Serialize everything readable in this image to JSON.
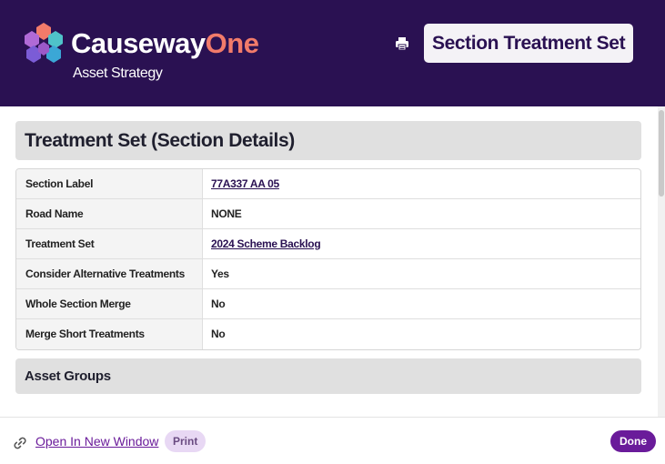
{
  "header": {
    "brand_primary": "Causeway",
    "brand_secondary": "One",
    "brand_subtitle": "Asset Strategy",
    "page_title": "Section Treatment Set",
    "print_icon": "printer-icon",
    "logo_icon": "causeway-logo-icon"
  },
  "main": {
    "details_heading": "Treatment Set (Section Details)",
    "rows": [
      {
        "label": "Section Label",
        "value": "77A337 AA 05",
        "link": true
      },
      {
        "label": "Road Name",
        "value": "NONE",
        "link": false
      },
      {
        "label": "Treatment Set",
        "value": "2024 Scheme Backlog",
        "link": true
      },
      {
        "label": "Consider Alternative Treatments",
        "value": "Yes",
        "link": false
      },
      {
        "label": "Whole Section Merge",
        "value": "No",
        "link": false
      },
      {
        "label": "Merge Short Treatments",
        "value": "No",
        "link": false
      }
    ],
    "asset_groups_heading": "Asset Groups"
  },
  "footer": {
    "link_icon": "link-icon",
    "open_new_window": "Open In New Window",
    "print_label": "Print",
    "done_label": "Done"
  },
  "colors": {
    "header_bg": "#2a1152",
    "brand_accent": "#f27b6a",
    "primary": "#6a1b9a",
    "print_chip": "#e8d8f4"
  }
}
